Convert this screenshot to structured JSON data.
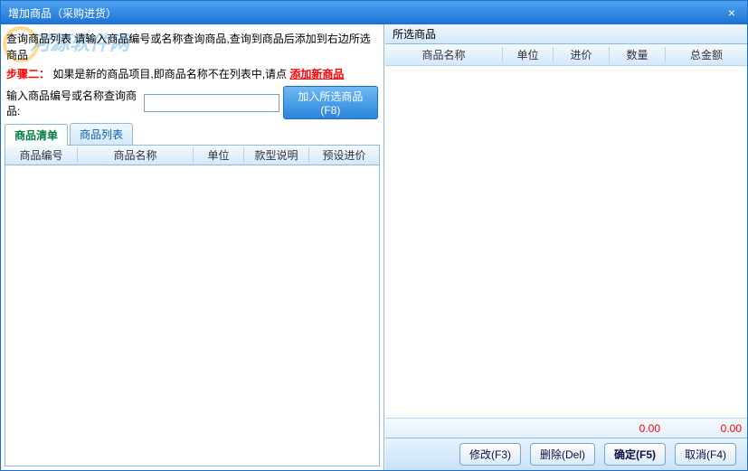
{
  "window": {
    "title": "增加商品（采购进货）",
    "close": "×"
  },
  "left": {
    "watermark": "河源软件网",
    "step1_label": "查询商品列表",
    "step1_text": "请输入商品编号或名称查询商品,查询到商品后添加到右边所选商品",
    "step2_label": "步骤二：",
    "step2_text": "如果是新的商品项目,即商品名称不在列表中,请点",
    "add_new_link": "添加新商品",
    "search_label": "输入商品编号或名称查询商品:",
    "search_value": "",
    "add_button": "加入所选商品(F8)",
    "tabs": [
      "商品清单",
      "商品列表"
    ],
    "columns": [
      "商品编号",
      "商品名称",
      "单位",
      "款型说明",
      "预设进价"
    ]
  },
  "right": {
    "title": "所选商品",
    "columns": [
      "商品名称",
      "单位",
      "进价",
      "数量",
      "总金额"
    ],
    "total_qty": "0.00",
    "total_amount": "0.00"
  },
  "buttons": {
    "modify": "修改(F3)",
    "delete": "删除(Del)",
    "ok": "确定(F5)",
    "cancel": "取消(F4)"
  }
}
